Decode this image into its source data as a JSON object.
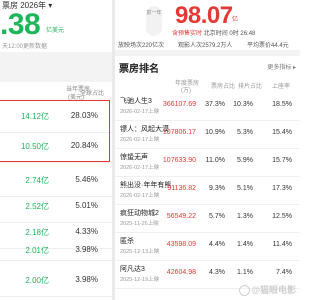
{
  "left": {
    "title": "票房 2026年 ▾",
    "big_value": ".38",
    "unit": "亿美元",
    "update": "天12:00更新数据",
    "header_col1_line1": "当年票房",
    "header_col1_line2": "(美元)",
    "header_col2": "全球占比",
    "rows": [
      {
        "amount": "14.12亿",
        "pct": "28.03%"
      },
      {
        "amount": "10.50亿",
        "pct": "20.84%"
      },
      {
        "amount": "2.74亿",
        "pct": "5.46%"
      },
      {
        "amount": "2.52亿",
        "pct": "5.01%"
      },
      {
        "amount": "2.18亿",
        "pct": "4.33%"
      },
      {
        "amount": "2.01亿",
        "pct": "3.98%"
      },
      {
        "amount": "2.00亿",
        "pct": "3.98%"
      }
    ]
  },
  "right": {
    "pill_label": "前一年",
    "big_value": "98.07",
    "unit": "亿",
    "live_label": "含预售实时",
    "live_time": "北京时间 0时 26:48",
    "stats": {
      "shows": "放映场次220亿次",
      "audience": "观影人次2579.2万人",
      "price": "平均票价44.4元"
    },
    "section_title": "票房排名",
    "more": "更多指标 ▸",
    "header": {
      "amount_line1": "年度票房",
      "amount_line2": "(万)",
      "c1": "票房占比",
      "c2": "排片占比",
      "c3": "上座率"
    },
    "movies": [
      {
        "name": "飞驰人生3",
        "date": "2026-02-17上映",
        "amount": "366107.69",
        "c1": "37.3%",
        "c2": "10.3%",
        "c3": "18.5%"
      },
      {
        "name": "镖人：风起大漠",
        "date": "2026-02-17上映",
        "amount": "107806.17",
        "c1": "10.9%",
        "c2": "5.3%",
        "c3": "15.4%"
      },
      {
        "name": "惊蛰无声",
        "date": "2026-02-17上映",
        "amount": "107633.90",
        "c1": "11.0%",
        "c2": "5.9%",
        "c3": "15.7%"
      },
      {
        "name": "熊出没·年年有熊",
        "date": "2026-02-17上映",
        "amount": "91136.82",
        "c1": "9.3%",
        "c2": "5.1%",
        "c3": "17.3%"
      },
      {
        "name": "疯狂动物城2",
        "date": "2025-11-26上映",
        "amount": "56549.22",
        "c1": "5.7%",
        "c2": "1.3%",
        "c3": "12.5%"
      },
      {
        "name": "匿杀",
        "date": "2025-12-13上映",
        "amount": "43598.09",
        "c1": "4.4%",
        "c2": "1.4%",
        "c3": "11.4%"
      },
      {
        "name": "阿凡达3",
        "date": "2025-12-19上映",
        "amount": "42604.98",
        "c1": "4.3%",
        "c2": "1.1%",
        "c3": "7.4%"
      }
    ]
  },
  "watermark": "@猫眼电影"
}
